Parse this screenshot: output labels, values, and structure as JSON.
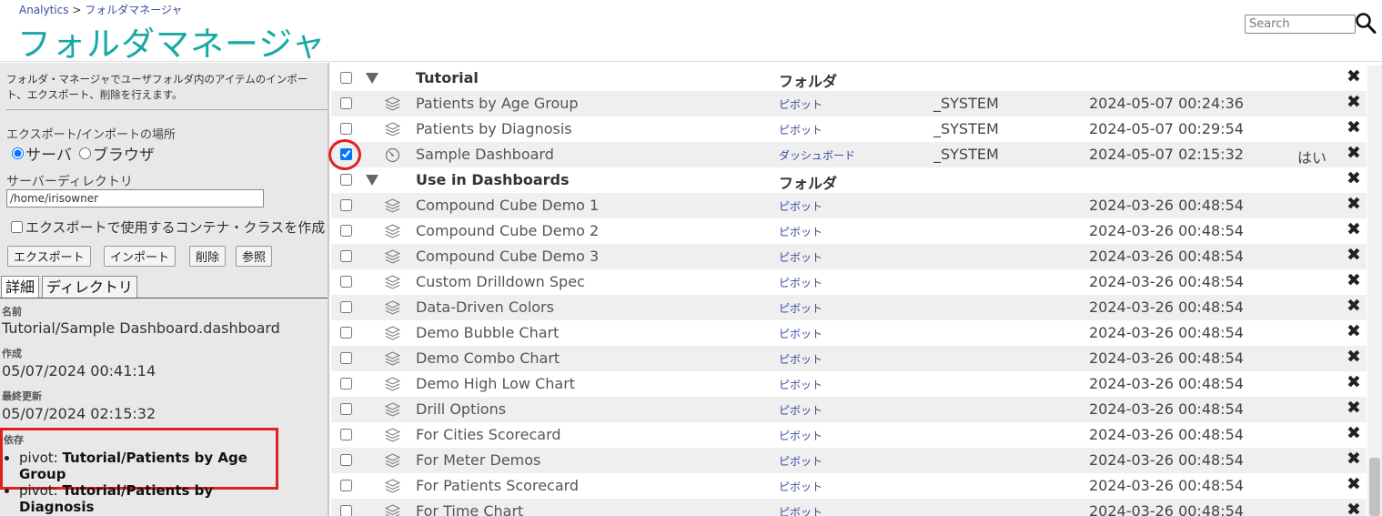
{
  "header": {
    "breadcrumb_root": "Analytics",
    "breadcrumb_sep": ">",
    "breadcrumb_current": "フォルダマネージャ",
    "title": "フォルダマネージャ",
    "search_placeholder": "Search"
  },
  "left_panel": {
    "description": "フォルダ・マネージャでユーザフォルダ内のアイテムのインポート、エクスポート、削除を行えます。",
    "location_label": "エクスポート/インポートの場所",
    "radio_server": "サーバ",
    "radio_browser": "ブラウザ",
    "server_dir_label": "サーバーディレクトリ",
    "server_dir_value": "/home/irisowner",
    "container_label": "エクスポートで使用するコンテナ・クラスを作成",
    "btn_export": "エクスポート",
    "btn_import": "インポート",
    "btn_delete": "削除",
    "btn_browse": "参照",
    "tab_details": "詳細",
    "tab_directory": "ディレクトリ",
    "details": {
      "name_label": "名前",
      "name_value": "Tutorial/Sample Dashboard.dashboard",
      "created_label": "作成",
      "created_value": "05/07/2024 00:41:14",
      "modified_label": "最終更新",
      "modified_value": "05/07/2024 02:15:32",
      "deps_label": "依存",
      "deps": [
        {
          "prefix": "pivot:",
          "name": "Tutorial/Patients by Age Group"
        },
        {
          "prefix": "pivot:",
          "name": "Tutorial/Patients by Diagnosis"
        }
      ]
    }
  },
  "rows": [
    {
      "kind": "folder",
      "name": "Tutorial",
      "type": "フォルダ",
      "owner": "",
      "date": "",
      "flag": "",
      "checked": false
    },
    {
      "kind": "pivot",
      "name": "Patients by Age Group",
      "type": "ピボット",
      "owner": "_SYSTEM",
      "date": "2024-05-07 00:24:36",
      "flag": "",
      "checked": false
    },
    {
      "kind": "pivot",
      "name": "Patients by Diagnosis",
      "type": "ピボット",
      "owner": "_SYSTEM",
      "date": "2024-05-07 00:29:54",
      "flag": "",
      "checked": false
    },
    {
      "kind": "dashboard",
      "name": "Sample Dashboard",
      "type": "ダッシュボード",
      "owner": "_SYSTEM",
      "date": "2024-05-07 02:15:32",
      "flag": "はい",
      "checked": true
    },
    {
      "kind": "folder",
      "name": "Use in Dashboards",
      "type": "フォルダ",
      "owner": "",
      "date": "",
      "flag": "",
      "checked": false
    },
    {
      "kind": "pivot",
      "name": "Compound Cube Demo 1",
      "type": "ピボット",
      "owner": "",
      "date": "2024-03-26 00:48:54",
      "flag": "",
      "checked": false
    },
    {
      "kind": "pivot",
      "name": "Compound Cube Demo 2",
      "type": "ピボット",
      "owner": "",
      "date": "2024-03-26 00:48:54",
      "flag": "",
      "checked": false
    },
    {
      "kind": "pivot",
      "name": "Compound Cube Demo 3",
      "type": "ピボット",
      "owner": "",
      "date": "2024-03-26 00:48:54",
      "flag": "",
      "checked": false
    },
    {
      "kind": "pivot",
      "name": "Custom Drilldown Spec",
      "type": "ピボット",
      "owner": "",
      "date": "2024-03-26 00:48:54",
      "flag": "",
      "checked": false
    },
    {
      "kind": "pivot",
      "name": "Data-Driven Colors",
      "type": "ピボット",
      "owner": "",
      "date": "2024-03-26 00:48:54",
      "flag": "",
      "checked": false
    },
    {
      "kind": "pivot",
      "name": "Demo Bubble Chart",
      "type": "ピボット",
      "owner": "",
      "date": "2024-03-26 00:48:54",
      "flag": "",
      "checked": false
    },
    {
      "kind": "pivot",
      "name": "Demo Combo Chart",
      "type": "ピボット",
      "owner": "",
      "date": "2024-03-26 00:48:54",
      "flag": "",
      "checked": false
    },
    {
      "kind": "pivot",
      "name": "Demo High Low Chart",
      "type": "ピボット",
      "owner": "",
      "date": "2024-03-26 00:48:54",
      "flag": "",
      "checked": false
    },
    {
      "kind": "pivot",
      "name": "Drill Options",
      "type": "ピボット",
      "owner": "",
      "date": "2024-03-26 00:48:54",
      "flag": "",
      "checked": false
    },
    {
      "kind": "pivot",
      "name": "For Cities Scorecard",
      "type": "ピボット",
      "owner": "",
      "date": "2024-03-26 00:48:54",
      "flag": "",
      "checked": false
    },
    {
      "kind": "pivot",
      "name": "For Meter Demos",
      "type": "ピボット",
      "owner": "",
      "date": "2024-03-26 00:48:54",
      "flag": "",
      "checked": false
    },
    {
      "kind": "pivot",
      "name": "For Patients Scorecard",
      "type": "ピボット",
      "owner": "",
      "date": "2024-03-26 00:48:54",
      "flag": "",
      "checked": false
    },
    {
      "kind": "pivot",
      "name": "For Time Chart",
      "type": "ピボット",
      "owner": "",
      "date": "2024-03-26 00:48:54",
      "flag": "",
      "checked": false
    }
  ],
  "icons": {
    "delete": "close-icon",
    "pivot": "cube-stack-icon",
    "dashboard": "gauge-icon",
    "folder": "expand-triangle-icon",
    "search": "search-icon"
  },
  "colors": {
    "title": "#17a9a5",
    "link": "#3b4aa0",
    "highlight": "#e02020"
  }
}
